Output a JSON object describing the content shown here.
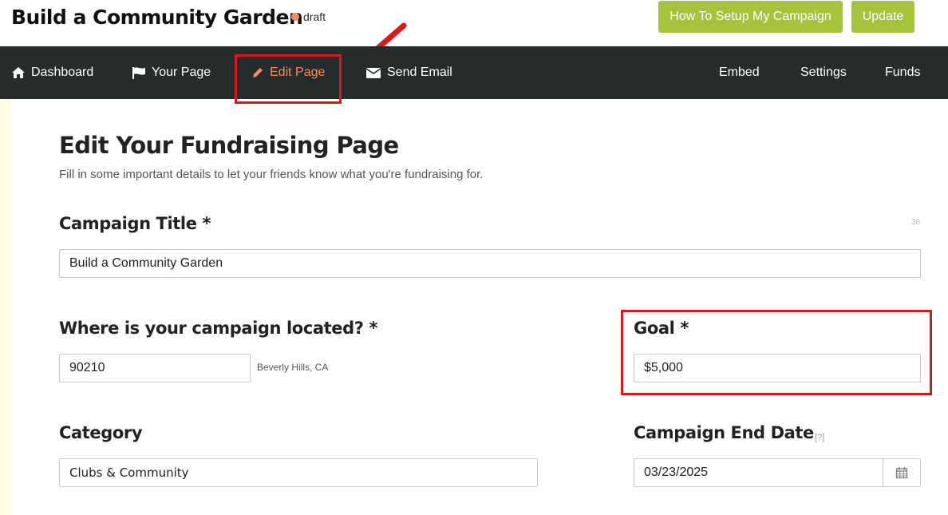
{
  "header": {
    "title": "Build a Community Garden",
    "status": "draft",
    "setup_button": "How To Setup My Campaign",
    "update_button": "Update"
  },
  "nav": {
    "dashboard": "Dashboard",
    "your_page": "Your Page",
    "edit_page": "Edit Page",
    "send_email": "Send Email",
    "embed": "Embed",
    "settings": "Settings",
    "funds": "Funds"
  },
  "main": {
    "title": "Edit Your Fundraising Page",
    "subtitle": "Fill in some important details to let your friends know what you're fundraising for."
  },
  "form": {
    "campaign_title_label": "Campaign Title *",
    "campaign_title_value": "Build a Community Garden",
    "campaign_title_count": "36",
    "location_label": "Where is your campaign located? *",
    "location_value": "90210",
    "location_hint": "Beverly Hills, CA",
    "goal_label": "Goal *",
    "goal_value": "$5,000",
    "category_label": "Category",
    "category_value": "Clubs & Community",
    "end_date_label": "Campaign End Date",
    "end_date_help": "[?]",
    "end_date_value": "03/23/2025"
  },
  "colors": {
    "accent_green": "#a3c43b",
    "nav_bg": "#262b2b",
    "active_orange": "#f58c5c",
    "highlight_red": "#d7191c"
  }
}
